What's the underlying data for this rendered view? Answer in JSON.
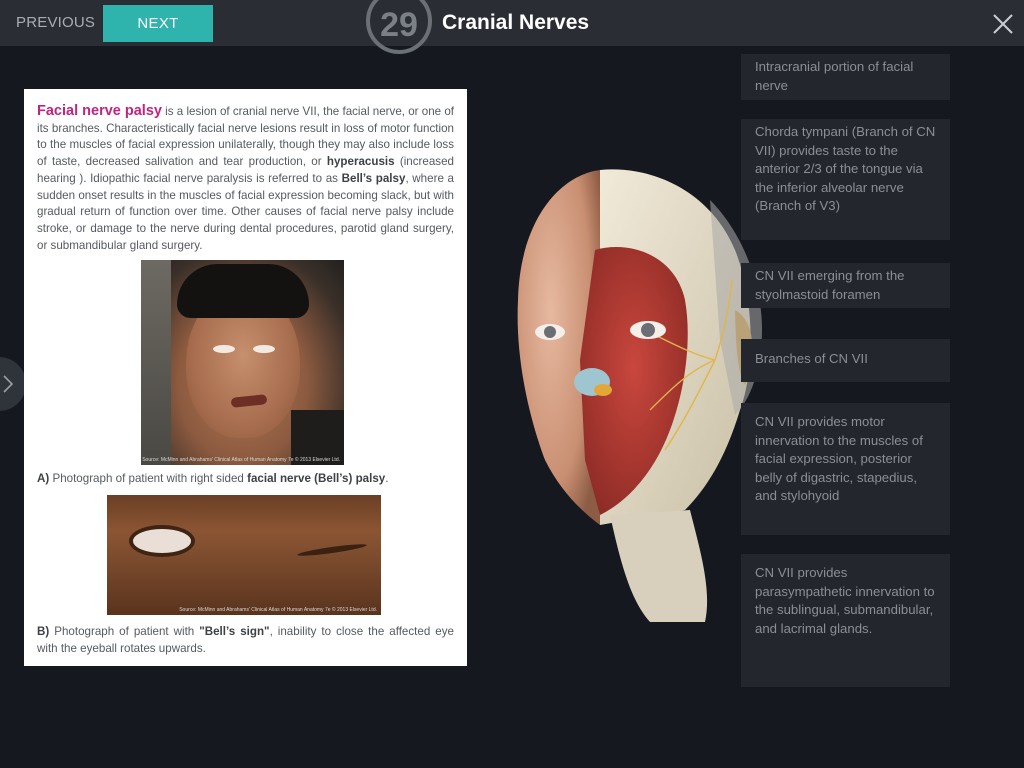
{
  "header": {
    "previous_label": "PREVIOUS",
    "next_label": "NEXT",
    "chapter_number": "29",
    "chapter_title": "Cranial Nerves",
    "close_icon": "close-icon"
  },
  "article": {
    "term_facial_palsy": "Facial nerve palsy",
    "text_1": " is a lesion of cranial nerve VII, the facial nerve,  or one of its branches.   Characteristically facial nerve lesions result in loss of motor function to the muscles of facial expression unilaterally, though they may also include loss of taste, decreased salivation and tear production, or ",
    "term_hyperacusis": "hyperacusis",
    "text_2": " (increased hearing ).  Idiopathic facial nerve paralysis is referred to as ",
    "term_bells_palsy": "Bell’s palsy",
    "text_3": ", where a sudden onset results in the muscles of facial expression becoming slack,  but with gradual return of function over time.  Other causes of facial nerve palsy include stroke, or damage to the nerve during dental procedures, parotid gland surgery, or submandibular gland surgery.",
    "photo_a_source": "Source: McMinn and Abrahams' Clinical Atlas of Human Anatomy 7e © 2013 Elsevier Ltd.",
    "caption_a_prefix": "A)",
    "caption_a_text": " Photograph of patient with right sided ",
    "caption_a_bold": "facial nerve (Bell’s) palsy",
    "caption_a_end": ".",
    "photo_b_source": "Source: McMinn and Abrahams' Clinical Atlas of Human Anatomy 7e © 2013 Elsevier Ltd.",
    "caption_b_prefix": "B)",
    "caption_b_text": " Photograph of patient with ",
    "caption_b_bold": "\"Bell’s sign\"",
    "caption_b_end": ", inability to close the affected eye with the eyeball rotates upwards."
  },
  "labels": [
    "Intracranial portion of facial nerve",
    "Chorda tympani (Branch of CN VII) provides taste to the anterior 2/3 of the tongue via the inferior alveolar nerve (Branch of V3)",
    "CN VII emerging from the styolmastoid foramen",
    "Branches of CN VII",
    "CN VII provides motor innervation to the muscles of facial expression, posterior belly of digastric, stapedius, and stylohyoid",
    "CN VII provides parasympathetic innervation to the sublingual, submandibular, and lacrimal glands."
  ],
  "colors": {
    "accent": "#2fb3ad",
    "highlight": "#c2247b",
    "topbar": "#2a2e34",
    "background": "#15191f"
  }
}
